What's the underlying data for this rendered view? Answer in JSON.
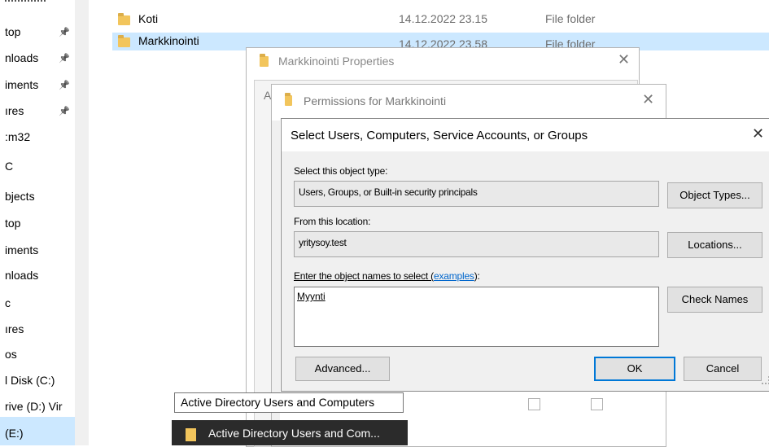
{
  "nav": {
    "items": [
      {
        "label": "top",
        "pinned": true
      },
      {
        "label": "nloads",
        "pinned": true
      },
      {
        "label": "iments",
        "pinned": true
      },
      {
        "label": "ıres",
        "pinned": true
      },
      {
        "label": ":m32",
        "pinned": false
      },
      {
        "label": "C",
        "pinned": false
      },
      {
        "label": "bjects",
        "pinned": false
      },
      {
        "label": "top",
        "pinned": false
      },
      {
        "label": "iments",
        "pinned": false
      },
      {
        "label": "nloads",
        "pinned": false
      },
      {
        "label": "c",
        "pinned": false
      },
      {
        "label": "ıres",
        "pinned": false
      },
      {
        "label": "os",
        "pinned": false
      },
      {
        "label": "l Disk (C:)",
        "pinned": false
      },
      {
        "label": "rive (D:) Vir",
        "pinned": false
      },
      {
        "label": "(E:)",
        "pinned": false
      }
    ]
  },
  "files": [
    {
      "name": "Koti",
      "date": "14.12.2022 23.15",
      "type": "File folder"
    },
    {
      "name": "Markkinointi",
      "date": "14.12.2022 23.58",
      "type": "File folder"
    }
  ],
  "properties_dialog": {
    "title": "Markkinointi Properties",
    "tab_fragment": "A"
  },
  "permissions_dialog": {
    "title": "Permissions for Markkinointi"
  },
  "select_dialog": {
    "title": "Select Users, Computers, Service Accounts, or Groups",
    "object_type_label": "Select this object type:",
    "object_type_value": "Users, Groups, or Built-in security principals",
    "object_types_button": "Object Types...",
    "location_label": "From this location:",
    "location_value": "yritysoy.test",
    "locations_button": "Locations...",
    "names_label_prefix": "Enter the object names to select (",
    "names_label_link": "examples",
    "names_label_suffix": "):",
    "names_value": "Myynti",
    "check_names_button": "Check Names",
    "advanced_button": "Advanced...",
    "ok_button": "OK",
    "cancel_button": "Cancel"
  },
  "tooltip": {
    "text": "Active Directory Users and Computers"
  },
  "taskbar_thumb": {
    "label": "Active Directory Users and Com..."
  },
  "colors": {
    "selection": "#cce8ff",
    "accent": "#0078d7",
    "folder": "#f2c55c"
  }
}
